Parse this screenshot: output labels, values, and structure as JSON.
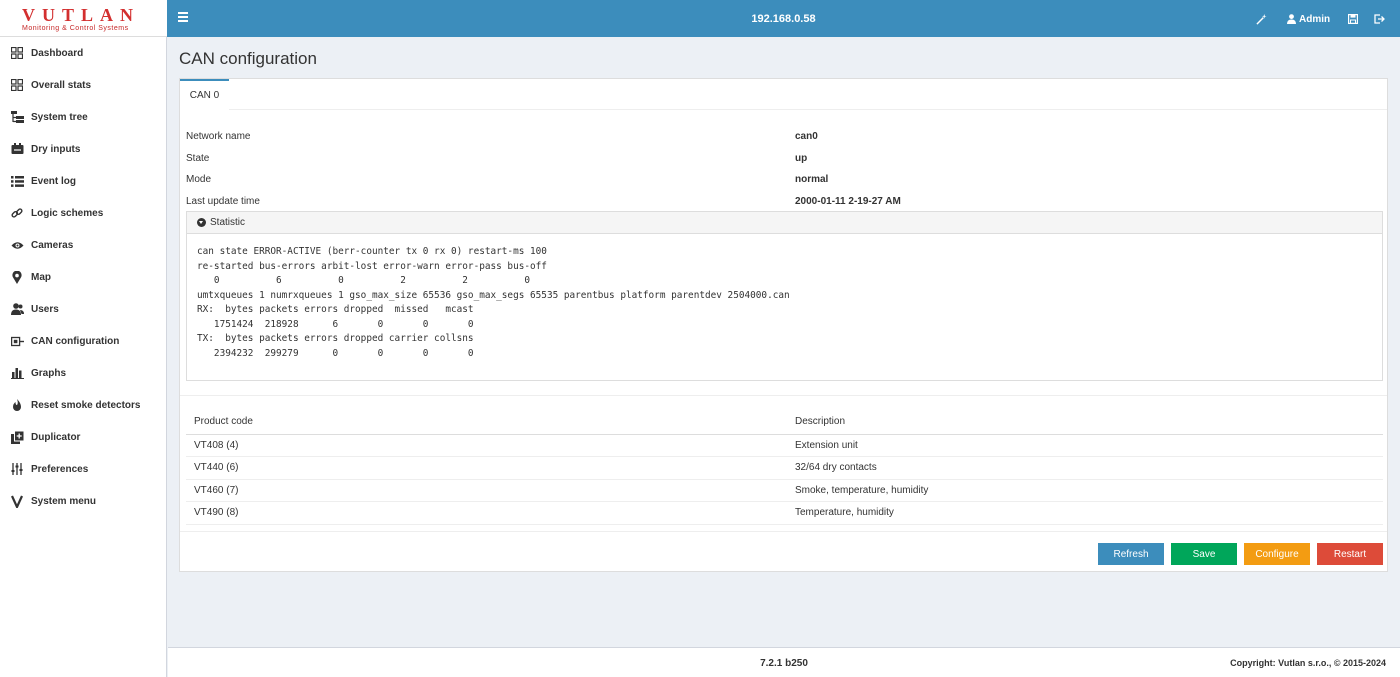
{
  "logo": {
    "title": "VUTLAN",
    "subtitle": "Monitoring & Control Systems"
  },
  "header": {
    "ip": "192.168.0.58",
    "user": "Admin"
  },
  "sidebar": {
    "items": [
      {
        "label": "Dashboard",
        "icon": "grid-icon"
      },
      {
        "label": "Overall stats",
        "icon": "grid-icon"
      },
      {
        "label": "System tree",
        "icon": "tree-icon"
      },
      {
        "label": "Dry inputs",
        "icon": "input-icon"
      },
      {
        "label": "Event log",
        "icon": "list-icon"
      },
      {
        "label": "Logic schemes",
        "icon": "link-icon"
      },
      {
        "label": "Cameras",
        "icon": "eye-icon"
      },
      {
        "label": "Map",
        "icon": "map-marker-icon"
      },
      {
        "label": "Users",
        "icon": "users-icon"
      },
      {
        "label": "CAN configuration",
        "icon": "plug-icon"
      },
      {
        "label": "Graphs",
        "icon": "bar-chart-icon"
      },
      {
        "label": "Reset smoke detectors",
        "icon": "fire-icon"
      },
      {
        "label": "Duplicator",
        "icon": "copy-icon"
      },
      {
        "label": "Preferences",
        "icon": "sliders-icon"
      },
      {
        "label": "System menu",
        "icon": "v-icon"
      }
    ]
  },
  "page": {
    "title": "CAN configuration"
  },
  "tabs": [
    {
      "label": "CAN 0"
    }
  ],
  "info": [
    {
      "label": "Network name",
      "value": "can0"
    },
    {
      "label": "State",
      "value": "up"
    },
    {
      "label": "Mode",
      "value": "normal"
    },
    {
      "label": "Last update time",
      "value": "2000-01-11 2-19-27 AM"
    }
  ],
  "statistic": {
    "title": "Statistic",
    "text": "can state ERROR-ACTIVE (berr-counter tx 0 rx 0) restart-ms 100\nre-started bus-errors arbit-lost error-warn error-pass bus-off\n   0          6          0          2          2          0\numtxqueues 1 numrxqueues 1 gso_max_size 65536 gso_max_segs 65535 parentbus platform parentdev 2504000.can\nRX:  bytes packets errors dropped  missed   mcast\n   1751424  218928      6       0       0       0\nTX:  bytes packets errors dropped carrier collsns\n   2394232  299279      0       0       0       0"
  },
  "products": {
    "headers": {
      "code": "Product code",
      "description": "Description"
    },
    "rows": [
      {
        "code": "VT408 (4)",
        "description": "Extension unit"
      },
      {
        "code": "VT440 (6)",
        "description": "32/64 dry contacts"
      },
      {
        "code": "VT460 (7)",
        "description": "Smoke, temperature, humidity"
      },
      {
        "code": "VT490 (8)",
        "description": "Temperature, humidity"
      }
    ]
  },
  "buttons": {
    "refresh": "Refresh",
    "save": "Save",
    "configure": "Configure",
    "restart": "Restart"
  },
  "footer": {
    "version": "7.2.1 b250",
    "copyright": "Copyright: Vutlan s.r.o., © 2015-2024"
  },
  "colors": {
    "header": "#3c8dbc",
    "refresh": "#3c8dbc",
    "save": "#00a65a",
    "configure": "#f39c12",
    "restart": "#dd4b39",
    "logo": "#d32f2f"
  }
}
